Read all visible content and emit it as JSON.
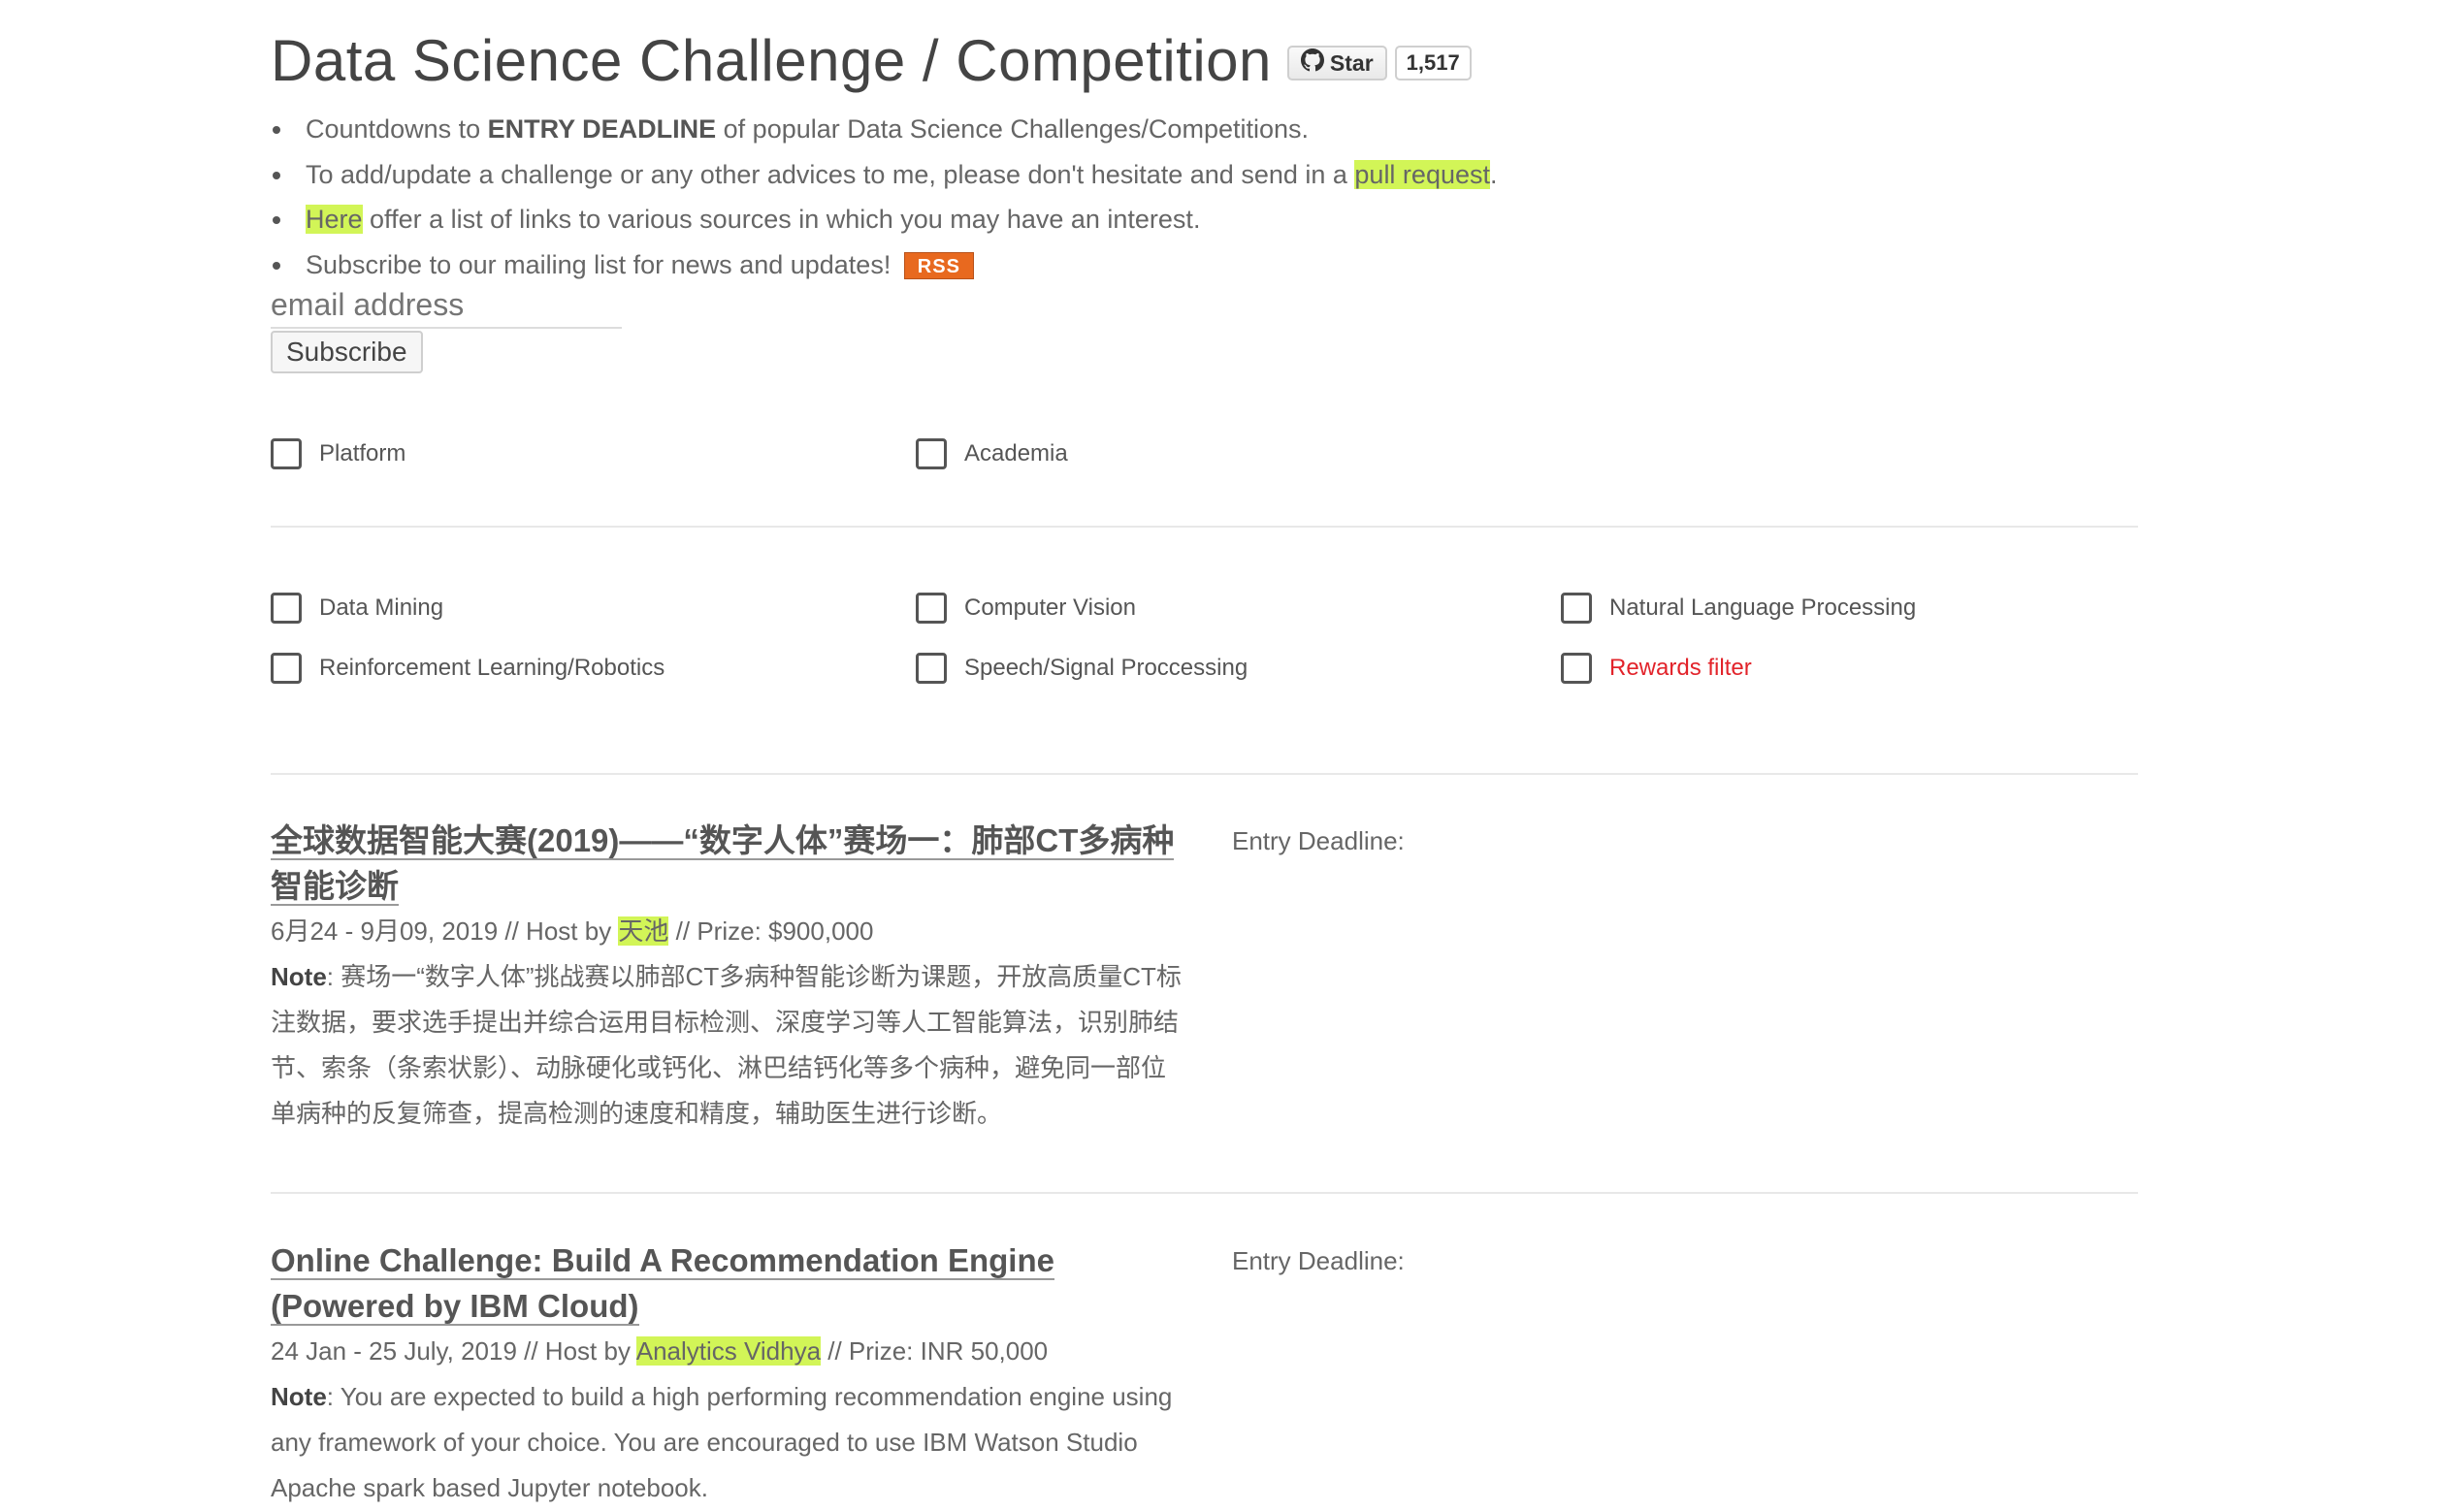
{
  "page_title": "Data Science Challenge / Competition",
  "github": {
    "star_label": "Star",
    "count": "1,517",
    "icon": "github-icon"
  },
  "intro": {
    "line1_pre": "Countdowns to ",
    "line1_bold": "ENTRY DEADLINE",
    "line1_post": " of popular Data Science Challenges/Competitions.",
    "line2_pre": "To add/update a challenge or any other advices to me, please don't hesitate and send in a ",
    "line2_link": "pull request",
    "line2_post": ".",
    "line3_link": "Here",
    "line3_post": " offer a list of links to various sources in which you may have an interest.",
    "line4_text": "Subscribe to our mailing list for news and updates!",
    "rss_label": "RSS"
  },
  "subscribe": {
    "email_placeholder": "email address",
    "button_label": "Subscribe"
  },
  "filters": {
    "source": [
      "Platform",
      "Academia"
    ],
    "topics": [
      "Data Mining",
      "Computer Vision",
      "Natural Language Processing",
      "Reinforcement Learning/Robotics",
      "Speech/Signal Proccessing",
      "Rewards filter"
    ]
  },
  "entries": [
    {
      "title": "全球数据智能大赛(2019)——“数字人体”赛场一：肺部CT多病种智能诊断",
      "dates": "6月24 - 9月09, 2019 // Host by ",
      "host": "天池",
      "prize": " // Prize: $900,000",
      "note_label": "Note",
      "note": ": 赛场一“数字人体”挑战赛以肺部CT多病种智能诊断为课题，开放高质量CT标注数据，要求选手提出并综合运用目标检测、深度学习等人工智能算法，识别肺结节、索条（条索状影）、动脉硬化或钙化、淋巴结钙化等多个病种，避免同一部位单病种的反复筛查，提高检测的速度和精度，辅助医生进行诊断。",
      "deadline_label": "Entry Deadline:"
    },
    {
      "title": "Online Challenge: Build A Recommendation Engine (Powered by IBM Cloud)",
      "dates": "24 Jan - 25 July, 2019 // Host by ",
      "host": "Analytics Vidhya",
      "prize": " // Prize: INR 50,000",
      "note_label": "Note",
      "note": ": You are expected to build a high performing recommendation engine using any framework of your choice. You are encouraged to use IBM Watson Studio Apache spark based Jupyter notebook.",
      "deadline_label": "Entry Deadline:"
    }
  ],
  "colors": {
    "highlight": "#d2f557",
    "rewards_red": "#e2232a",
    "rss_orange": "#e8691f"
  }
}
